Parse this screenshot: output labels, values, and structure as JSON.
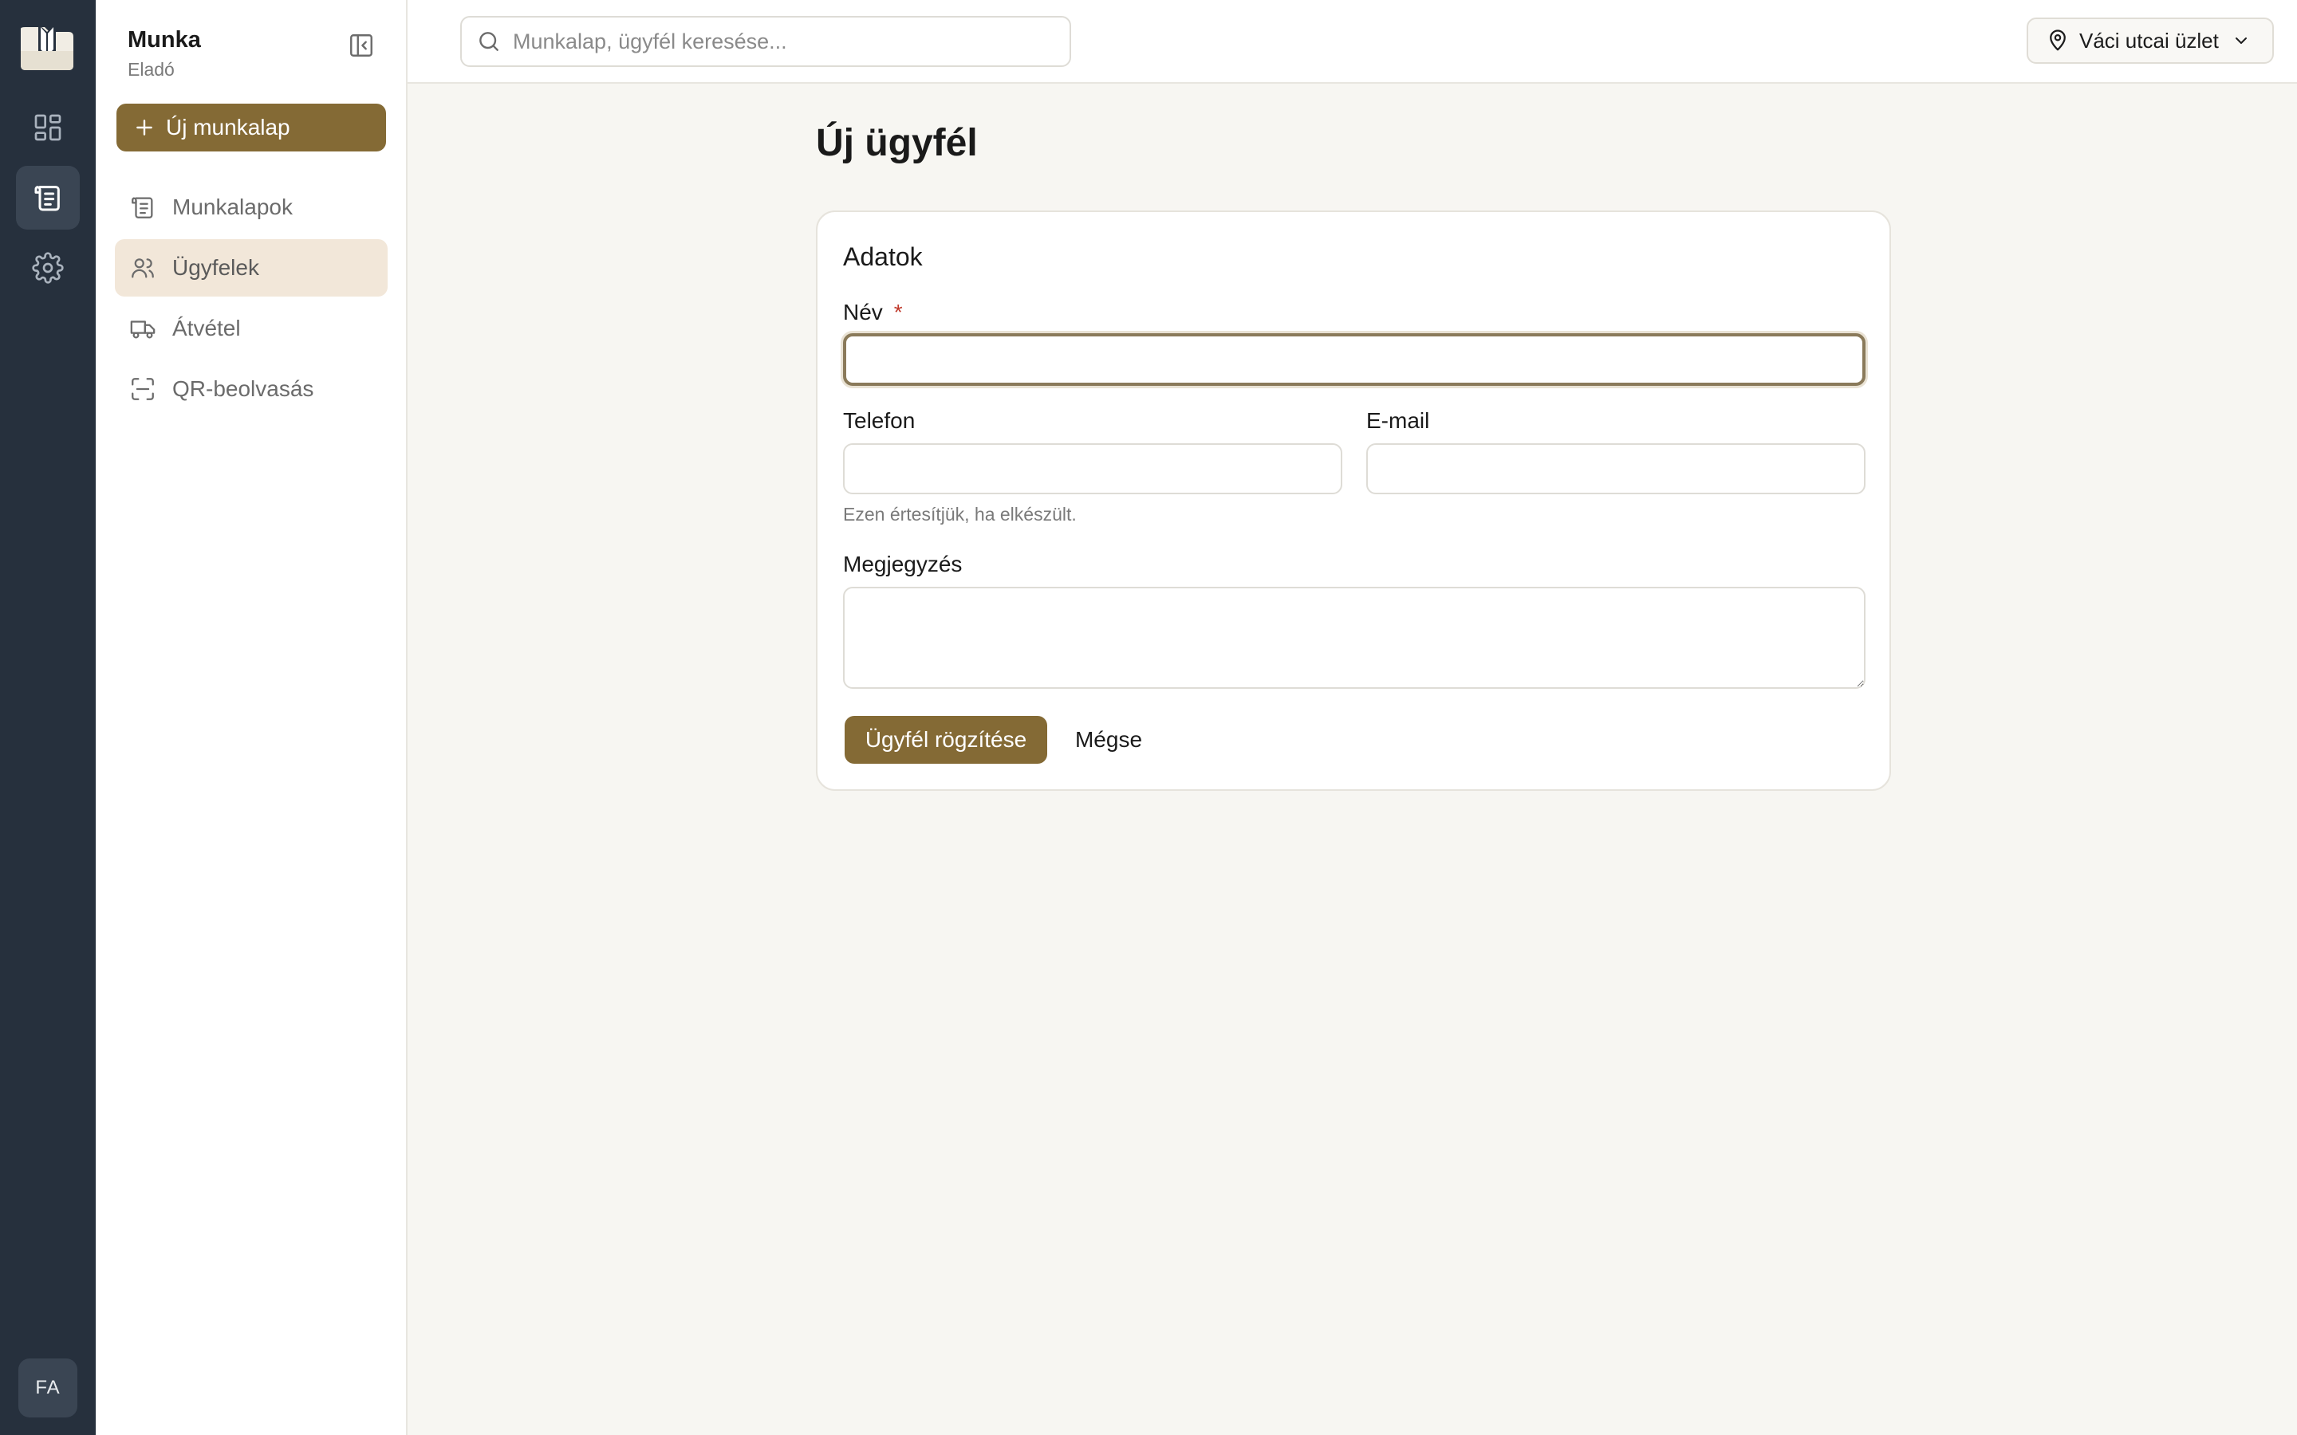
{
  "rail": {
    "items": [
      {
        "icon": "dashboard-icon"
      },
      {
        "icon": "worksheet-icon",
        "active": true
      },
      {
        "icon": "gear-icon"
      }
    ],
    "avatar_initials": "FA"
  },
  "sidebar": {
    "title": "Munka",
    "subtitle": "Eladó",
    "new_button_label": "Új munkalap",
    "items": [
      {
        "label": "Munkalapok",
        "icon": "worksheet-icon"
      },
      {
        "label": "Ügyfelek",
        "icon": "users-icon",
        "active": true
      },
      {
        "label": "Átvétel",
        "icon": "truck-icon"
      },
      {
        "label": "QR-beolvasás",
        "icon": "qr-scan-icon"
      }
    ]
  },
  "topbar": {
    "search_placeholder": "Munkalap, ügyfél keresése...",
    "store_label": "Váci utcai üzlet"
  },
  "main": {
    "title": "Új ügyfél",
    "card_title": "Adatok",
    "name_label": "Név",
    "required_mark": "*",
    "name_value": "",
    "phone_label": "Telefon",
    "phone_value": "",
    "phone_hint": "Ezen értesítjük, ha elkészült.",
    "email_label": "E-mail",
    "email_value": "",
    "note_label": "Megjegyzés",
    "note_value": "",
    "save_button": "Ügyfél rögzítése",
    "cancel_button": "Mégse"
  },
  "colors": {
    "rail_bg": "#26303d",
    "accent": "#846a35",
    "active_nav_bg": "#f2e7d9",
    "page_bg": "#f7f6f2"
  }
}
